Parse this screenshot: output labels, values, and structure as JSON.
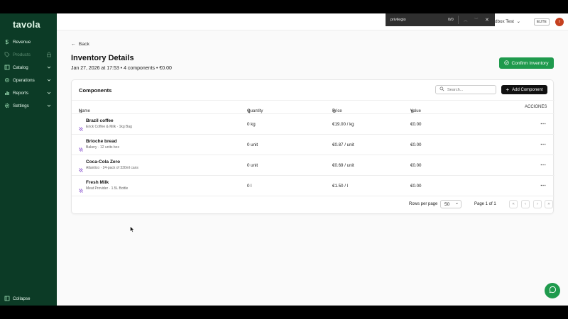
{
  "sidebar": {
    "logo": "tavola",
    "items": [
      {
        "label": "Revenue",
        "icon": "dollar-icon",
        "disabled": false,
        "chevron": false
      },
      {
        "label": "Products",
        "icon": "tag-icon",
        "disabled": true,
        "chevron": false
      },
      {
        "label": "Catalog",
        "icon": "book-icon",
        "disabled": false,
        "chevron": true
      },
      {
        "label": "Operations",
        "icon": "truck-icon",
        "disabled": false,
        "chevron": true
      },
      {
        "label": "Reports",
        "icon": "bar-chart-icon",
        "disabled": false,
        "chevron": true
      },
      {
        "label": "Settings",
        "icon": "gear-icon",
        "disabled": false,
        "chevron": true
      }
    ],
    "collapse_label": "Collapse"
  },
  "findbar": {
    "query": "privilegio",
    "count": "0/0"
  },
  "account": {
    "name": "dbox Test",
    "plan": "ELITE",
    "avatar_initial": "I"
  },
  "page": {
    "back_label": "Back",
    "title": "Inventory Details",
    "subtitle": "Jan 27, 2026 at 17:53 • 4 components • €0.00",
    "confirm_label": "Confirm Inventory"
  },
  "components": {
    "title": "Components",
    "search_placeholder": "Search...",
    "add_label": "Add Component",
    "columns": {
      "name": "Name",
      "quantity": "Quantity",
      "price": "Price",
      "value": "Value",
      "actions": "ACCIONES"
    },
    "rows": [
      {
        "name": "Brazil coffee",
        "detail": "Erick Coffee & Milk · 1kg Bag",
        "quantity": "0 kg",
        "price": "€19.00 / kg",
        "value": "€0.00"
      },
      {
        "name": "Brioche bread",
        "detail": "Bakery · 12 units box",
        "quantity": "0 unit",
        "price": "€0.87 / unit",
        "value": "€0.00"
      },
      {
        "name": "Coca-Cola Zero",
        "detail": "Atlantico · 24-pack of 330ml cans",
        "quantity": "0 unit",
        "price": "€0.69 / unit",
        "value": "€0.00"
      },
      {
        "name": "Fresh Milk",
        "detail": "Meat Provider · 1.5L Bottle",
        "quantity": "0 l",
        "price": "€1.50 / l",
        "value": "€0.00"
      }
    ],
    "rows_per_page_label": "Rows per page",
    "rows_per_page": "50",
    "page_info": "Page 1 of 1"
  },
  "colors": {
    "sidebar": "#0c3b26",
    "accent": "#1f9a4d"
  }
}
